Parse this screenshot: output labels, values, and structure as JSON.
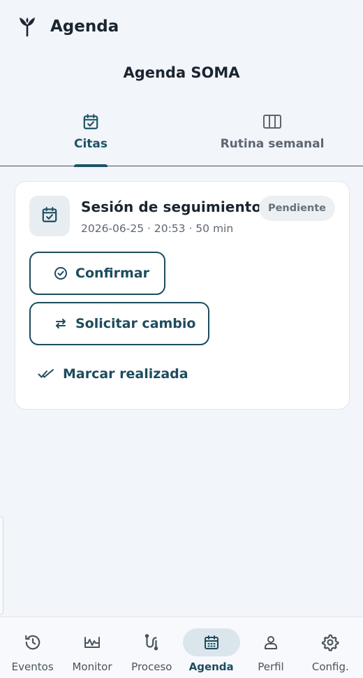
{
  "appbar": {
    "title": "Agenda",
    "logo_icon": "sprout-logo-icon"
  },
  "page": {
    "title": "Agenda SOMA"
  },
  "tabs": [
    {
      "label": "Citas",
      "icon": "calendar-check-icon",
      "active": true
    },
    {
      "label": "Rutina semanal",
      "icon": "columns-icon",
      "active": false
    }
  ],
  "appointment": {
    "title": "Sesión de seguimiento",
    "meta": "2026-06-25 · 20:53 · 50 min",
    "status": "Pendiente",
    "icon": "calendar-check-icon",
    "actions": {
      "confirm": "Confirmar",
      "request_change": "Solicitar cambio",
      "mark_done": "Marcar realizada"
    }
  },
  "bottom_nav": [
    {
      "label": "Eventos",
      "icon": "history-icon",
      "active": false
    },
    {
      "label": "Monitor",
      "icon": "monitor-wave-icon",
      "active": false
    },
    {
      "label": "Proceso",
      "icon": "route-icon",
      "active": false
    },
    {
      "label": "Agenda",
      "icon": "calendar-icon",
      "active": true
    },
    {
      "label": "Perfil",
      "icon": "person-icon",
      "active": false
    },
    {
      "label": "Config.",
      "icon": "gear-icon",
      "active": false
    }
  ],
  "colors": {
    "accent": "#1d4c5e",
    "background": "#f2f5fa",
    "badge_bg": "#edf0f3",
    "nav_active_bg": "#dbe5ec"
  }
}
